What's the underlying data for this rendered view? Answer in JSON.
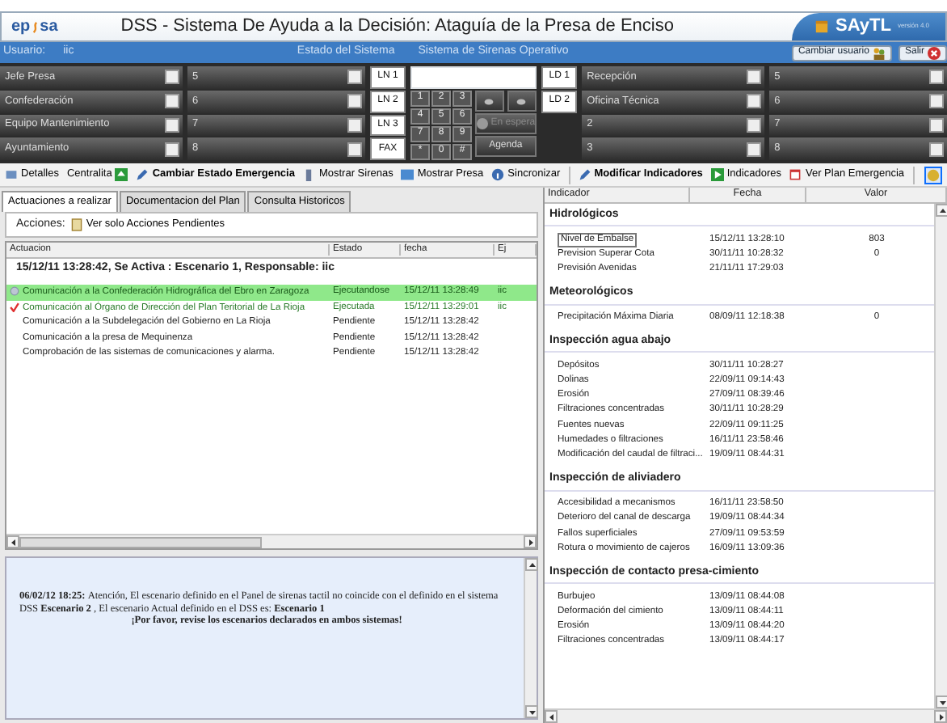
{
  "header": {
    "logo_left": "ep",
    "logo_right": "sa",
    "title": "DSS - Sistema De Ayuda a la Decisión: Ataguía de la Presa de Enciso",
    "brand": "SAyTL",
    "version": "versión 4.0"
  },
  "status_bar": {
    "user_label": "Usuario:",
    "user": "iic",
    "state_label": "Estado del Sistema",
    "state": "Sistema de Sirenas Operativo",
    "buttons": [
      "Cambiar usuario",
      "Salir"
    ]
  },
  "contacts_left": [
    {
      "name": "Jefe Presa",
      "value": "5"
    },
    {
      "name": "Confederación",
      "value": "6"
    },
    {
      "name": "Equipo Mantenimiento",
      "value": "7"
    },
    {
      "name": "Ayuntamiento",
      "value": "8"
    }
  ],
  "lines_left": [
    "LN 1",
    "LN 2",
    "LN 3",
    "FAX"
  ],
  "keypad": [
    "1",
    "2",
    "3",
    "4",
    "5",
    "6",
    "7",
    "8",
    "9",
    "*",
    "0",
    "#"
  ],
  "phone_buttons": [
    {
      "label": "En espera",
      "disabled": true
    },
    {
      "label": "Agenda",
      "disabled": false
    }
  ],
  "lines_right": [
    "LD 1",
    "LD 2"
  ],
  "contacts_right": [
    {
      "name": "Recepción",
      "value": "5"
    },
    {
      "name": "Oficina Técnica",
      "value": "6"
    },
    {
      "name": "2",
      "value": "7"
    },
    {
      "name": "3",
      "value": "8"
    }
  ],
  "toolbar": [
    {
      "label": "Detalles",
      "bold": false
    },
    {
      "label": "Centralita",
      "bold": false
    },
    {
      "label": "Cambiar Estado Emergencia",
      "bold": true
    },
    {
      "label": "Mostrar Sirenas",
      "bold": false
    },
    {
      "label": "Mostrar Presa",
      "bold": false
    },
    {
      "label": "Sincronizar",
      "bold": false
    },
    {
      "label": "Modificar Indicadores",
      "bold": true
    },
    {
      "label": "Indicadores",
      "bold": false
    },
    {
      "label": "Ver Plan Emergencia",
      "bold": false
    }
  ],
  "tabs": [
    {
      "label": "Actuaciones a realizar",
      "selected": true
    },
    {
      "label": "Documentacion del Plan",
      "selected": false
    },
    {
      "label": "Consulta Historicos",
      "selected": false
    }
  ],
  "actions": {
    "label": "Acciones:",
    "filter": "Ver solo Acciones Pendientes"
  },
  "table": {
    "columns": [
      "Actuacion",
      "Estado",
      "fecha",
      "Ej"
    ],
    "group": "15/12/11 13:28:42, Se Activa : Escenario 1, Responsable: iic",
    "rows": [
      {
        "kind": "running",
        "cells": [
          "Comunicación a la Confederación Hidrográfica del Ebro en Zaragoza",
          "Ejecutandose",
          "15/12/11 13:28:49",
          "iic"
        ]
      },
      {
        "kind": "done",
        "cells": [
          "Comunicación al Órgano de Dirección del Plan Teritorial de La Rioja",
          "Ejecutada",
          "15/12/11 13:29:01",
          "iic"
        ]
      },
      {
        "kind": "pending",
        "cells": [
          "Comunicación a la Subdelegación del Gobierno en La Rioja",
          "Pendiente",
          "15/12/11 13:28:42"
        ]
      },
      {
        "kind": "pending",
        "cells": [
          "Comunicación a la presa de Mequinenza",
          "Pendiente",
          "15/12/11 13:28:42"
        ]
      },
      {
        "kind": "pending",
        "cells": [
          "Comprobación de las sistemas de comunicaciones y alarma.",
          "Pendiente",
          "15/12/11 13:28:42"
        ]
      }
    ]
  },
  "message": {
    "date": "06/02/12 18:25:",
    "text": "Atención, El escenario definido en el Panel de sirenas tactil no coincide con el definido en el sistema DSS **Escenario 2** , El escenario Actual definido en el DSS es: **Escenario 1**",
    "warning": "¡Por favor, revise los escenarios declarados en ambos sistemas!"
  },
  "indicators": {
    "columns": [
      "Indicador",
      "Fecha",
      "Valor"
    ],
    "groups": [
      {
        "title": "Hidrológicos",
        "items": [
          {
            "name": "Nivel de Embalse",
            "date": "15/12/11 13:28:10",
            "value": "803",
            "selected": true
          },
          {
            "name": "Prevision Superar Cota",
            "date": "30/11/11 10:28:32",
            "value": "0",
            "selected": false
          },
          {
            "name": "Previsión Avenidas",
            "date": "21/11/11 17:29:03",
            "selected": false
          }
        ]
      },
      {
        "title": "Meteorológicos",
        "items": [
          {
            "name": "Precipitación Máxima Diaria",
            "date": "08/09/11 12:18:38",
            "value": "0",
            "selected": false
          }
        ]
      },
      {
        "title": "Inspección agua abajo",
        "items": [
          {
            "name": "Depósitos",
            "date": "30/11/11 10:28:27",
            "selected": false
          },
          {
            "name": "Dolinas",
            "date": "22/09/11 09:14:43",
            "selected": false
          },
          {
            "name": "Erosión",
            "date": "27/09/11 08:39:46",
            "selected": false
          },
          {
            "name": "Filtraciones concentradas",
            "date": "30/11/11 10:28:29",
            "selected": false
          },
          {
            "name": "Fuentes nuevas",
            "date": "22/09/11 09:11:25",
            "selected": false
          },
          {
            "name": "Humedades o filtraciones",
            "date": "16/11/11 23:58:46",
            "selected": false
          },
          {
            "name": "Modificación del caudal de filtraci...",
            "date": "19/09/11 08:44:31",
            "selected": false
          }
        ]
      },
      {
        "title": "Inspección de aliviadero",
        "items": [
          {
            "name": "Accesibilidad a mecanismos",
            "date": "16/11/11 23:58:50",
            "selected": false
          },
          {
            "name": "Deterioro del canal de descarga",
            "date": "19/09/11 08:44:34",
            "selected": false
          },
          {
            "name": "Fallos superficiales",
            "date": "27/09/11 09:53:59",
            "selected": false
          },
          {
            "name": "Rotura o movimiento de cajeros",
            "date": "16/09/11 13:09:36",
            "selected": false
          }
        ]
      },
      {
        "title": "Inspección de contacto presa-cimiento",
        "items": [
          {
            "name": "Burbujeo",
            "date": "13/09/11 08:44:08",
            "selected": false
          },
          {
            "name": "Deformación del cimiento",
            "date": "13/09/11 08:44:11",
            "selected": false
          },
          {
            "name": "Erosión",
            "date": "13/09/11 08:44:20",
            "selected": false
          },
          {
            "name": "Filtraciones concentradas",
            "date": "13/09/11 08:44:17",
            "selected": false
          }
        ]
      }
    ]
  }
}
